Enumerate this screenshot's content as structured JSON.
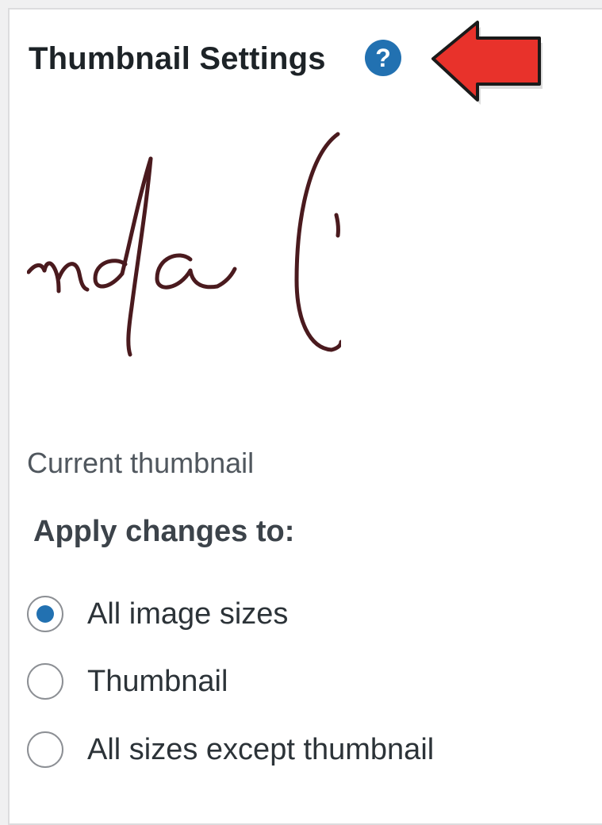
{
  "thumbnail_settings": {
    "title": "Thumbnail Settings",
    "help_glyph": "?",
    "current_thumbnail_caption": "Current thumbnail",
    "apply_label": "Apply changes to:",
    "options": [
      {
        "label": "All image sizes",
        "selected": true
      },
      {
        "label": "Thumbnail",
        "selected": false
      },
      {
        "label": "All sizes except thumbnail",
        "selected": false
      }
    ]
  },
  "icons": {
    "help": "question-circle-icon",
    "annotation": "red-arrow-left-icon"
  },
  "colors": {
    "accent": "#2271b1",
    "annotation_arrow": "#e8322b",
    "signature_ink": "#4a1a1e"
  }
}
